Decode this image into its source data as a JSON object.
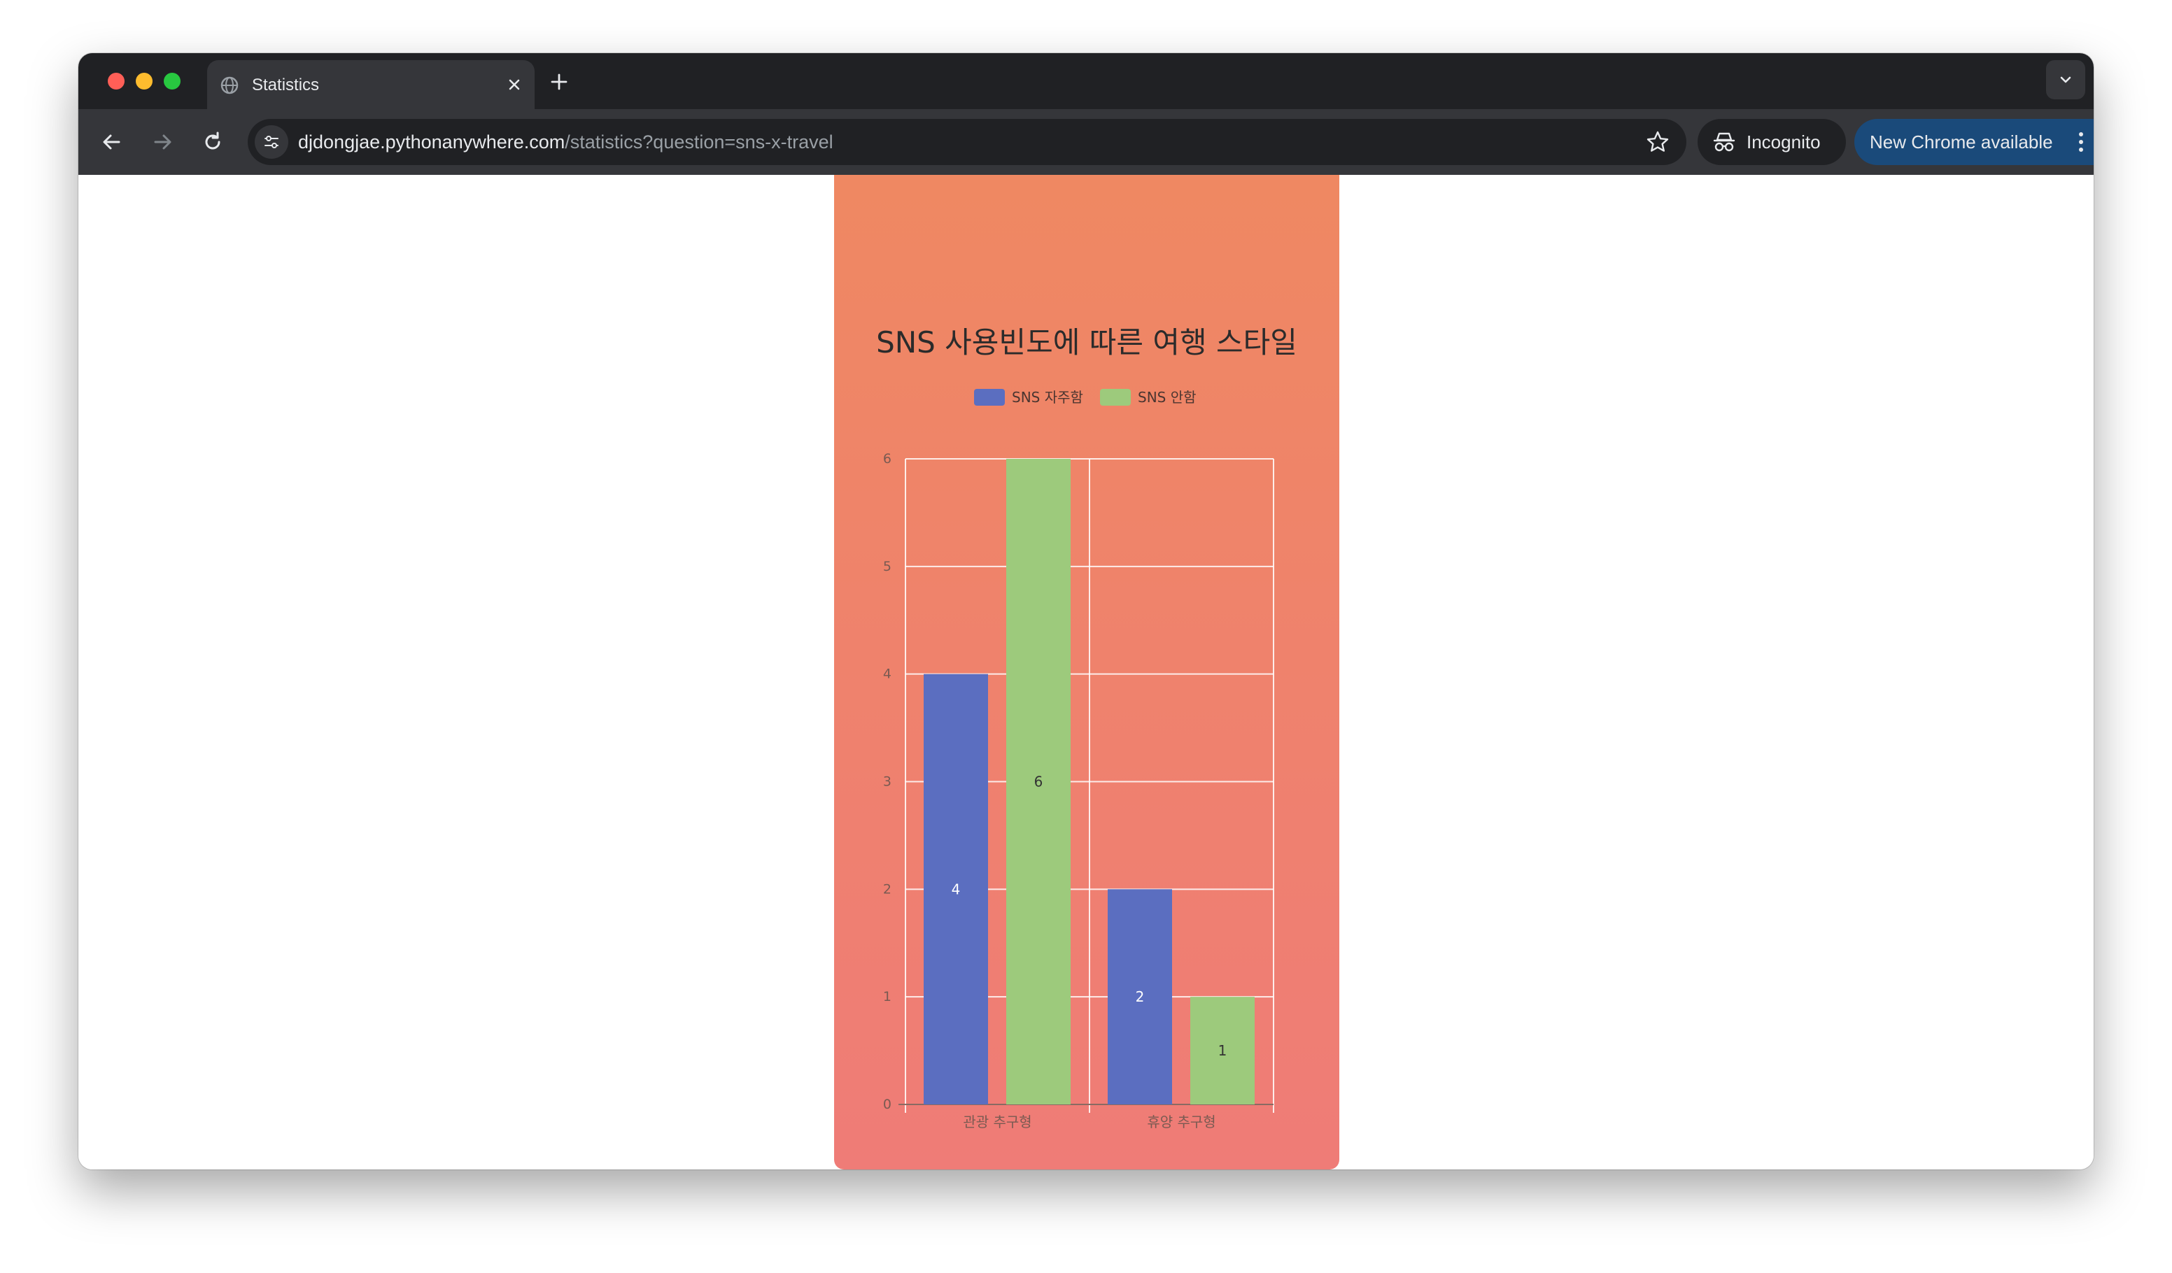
{
  "browser": {
    "tab_title": "Statistics",
    "url_host": "djdongjae.pythonanywhere.com",
    "url_path": "/statistics?question=sns-x-travel",
    "incognito_label": "Incognito",
    "update_label": "New Chrome available"
  },
  "colors": {
    "card_top": "#ef8862",
    "card_bottom": "#ef7c77",
    "series_1": "#5b6ec0",
    "series_2": "#9dca7c"
  },
  "chart_data": {
    "type": "bar",
    "title": "SNS 사용빈도에 따른 여행 스타일",
    "categories": [
      "관광 추구형",
      "휴양 추구형"
    ],
    "series": [
      {
        "name": "SNS 자주함",
        "values": [
          4,
          2
        ],
        "color": "#5b6ec0"
      },
      {
        "name": "SNS 안함",
        "values": [
          6,
          1
        ],
        "color": "#9dca7c"
      }
    ],
    "ylim": [
      0,
      6
    ],
    "yticks": [
      0,
      1,
      2,
      3,
      4,
      5,
      6
    ],
    "grid": true,
    "legend": "top-center",
    "data_labels": true
  }
}
